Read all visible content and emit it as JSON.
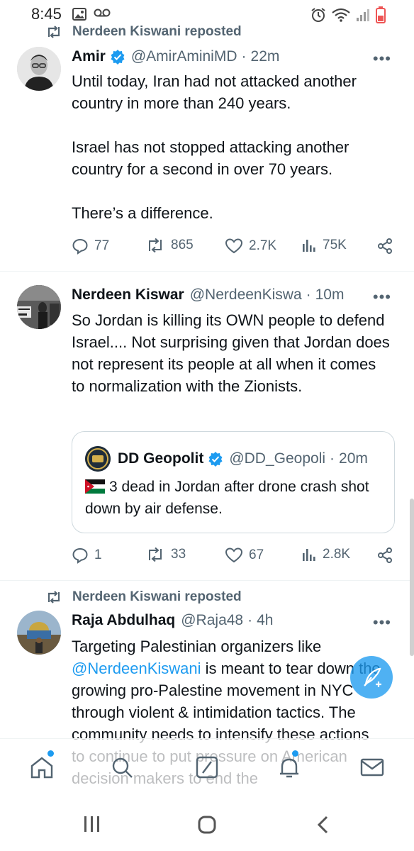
{
  "status_bar": {
    "time": "8:45"
  },
  "tweets": [
    {
      "repost_label": "Nerdeen Kiswani reposted",
      "author": "Amir",
      "verified": true,
      "handle": "@AmirAminiMD",
      "time": "22m",
      "paragraphs": [
        "Until today, Iran had not attacked another country in more than 240 years.",
        "Israel has not stopped attacking  another country for a second in over 70 years.",
        "There’s a difference."
      ],
      "stats": {
        "replies": "77",
        "reposts": "865",
        "likes": "2.7K",
        "views": "75K"
      }
    },
    {
      "author": "Nerdeen Kiswar",
      "handle": "@NerdeenKiswa",
      "time": "10m",
      "text": "So Jordan is killing its OWN people to defend Israel.... Not surprising given that Jordan does not represent its people at all when it comes to normalization with the Zionists.",
      "quote": {
        "author": "DD Geopolit",
        "verified": true,
        "handle": "@DD_Geopoli",
        "time": "20m",
        "text": "3 dead in Jordan after drone crash shot down by air defense."
      },
      "stats": {
        "replies": "1",
        "reposts": "33",
        "likes": "67",
        "views": "2.8K"
      }
    },
    {
      "repost_label": "Nerdeen Kiswani reposted",
      "author": "Raja Abdulhaq",
      "handle": "@Raja48",
      "time": "4h",
      "mention": "@NerdeenKiswani",
      "text_before": "Targeting Palestinian organizers like",
      "text_after": " is meant to tear down the growing pro-Palestine movement in NYC through violent & intimidation tactics. The community needs to intensify these actions to continue to put pressure on American decision makers to end the"
    }
  ],
  "colors": {
    "accent": "#1d9bf0",
    "text": "#0f1419",
    "secondary": "#536471",
    "border": "#cfd9de"
  },
  "icons": [
    "repost-icon",
    "verified-badge-icon",
    "more-icon",
    "reply-icon",
    "like-icon",
    "views-icon",
    "share-icon",
    "home-icon",
    "search-icon",
    "grok-icon",
    "notifications-icon",
    "messages-icon",
    "compose-icon"
  ]
}
